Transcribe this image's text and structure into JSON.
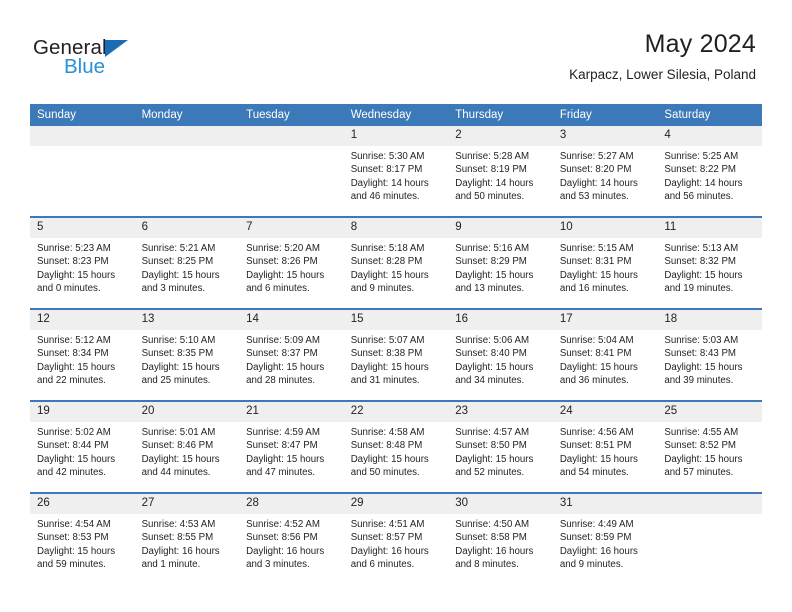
{
  "brand": {
    "name_part1": "General",
    "name_part2": "Blue",
    "triangle_color": "#1b6cb5",
    "blue_text_color": "#2b8fd6"
  },
  "header": {
    "title": "May 2024",
    "subtitle": "Karpacz, Lower Silesia, Poland"
  },
  "theme": {
    "header_bg": "#3b79b8",
    "daynum_bg": "#efefef",
    "text": "#231f20"
  },
  "weekday_headers": [
    "Sunday",
    "Monday",
    "Tuesday",
    "Wednesday",
    "Thursday",
    "Friday",
    "Saturday"
  ],
  "weeks": [
    [
      {
        "day": "",
        "sunrise": "",
        "sunset": "",
        "daylight_line1": "",
        "daylight_line2": ""
      },
      {
        "day": "",
        "sunrise": "",
        "sunset": "",
        "daylight_line1": "",
        "daylight_line2": ""
      },
      {
        "day": "",
        "sunrise": "",
        "sunset": "",
        "daylight_line1": "",
        "daylight_line2": ""
      },
      {
        "day": "1",
        "sunrise": "Sunrise: 5:30 AM",
        "sunset": "Sunset: 8:17 PM",
        "daylight_line1": "Daylight: 14 hours",
        "daylight_line2": "and 46 minutes."
      },
      {
        "day": "2",
        "sunrise": "Sunrise: 5:28 AM",
        "sunset": "Sunset: 8:19 PM",
        "daylight_line1": "Daylight: 14 hours",
        "daylight_line2": "and 50 minutes."
      },
      {
        "day": "3",
        "sunrise": "Sunrise: 5:27 AM",
        "sunset": "Sunset: 8:20 PM",
        "daylight_line1": "Daylight: 14 hours",
        "daylight_line2": "and 53 minutes."
      },
      {
        "day": "4",
        "sunrise": "Sunrise: 5:25 AM",
        "sunset": "Sunset: 8:22 PM",
        "daylight_line1": "Daylight: 14 hours",
        "daylight_line2": "and 56 minutes."
      }
    ],
    [
      {
        "day": "5",
        "sunrise": "Sunrise: 5:23 AM",
        "sunset": "Sunset: 8:23 PM",
        "daylight_line1": "Daylight: 15 hours",
        "daylight_line2": "and 0 minutes."
      },
      {
        "day": "6",
        "sunrise": "Sunrise: 5:21 AM",
        "sunset": "Sunset: 8:25 PM",
        "daylight_line1": "Daylight: 15 hours",
        "daylight_line2": "and 3 minutes."
      },
      {
        "day": "7",
        "sunrise": "Sunrise: 5:20 AM",
        "sunset": "Sunset: 8:26 PM",
        "daylight_line1": "Daylight: 15 hours",
        "daylight_line2": "and 6 minutes."
      },
      {
        "day": "8",
        "sunrise": "Sunrise: 5:18 AM",
        "sunset": "Sunset: 8:28 PM",
        "daylight_line1": "Daylight: 15 hours",
        "daylight_line2": "and 9 minutes."
      },
      {
        "day": "9",
        "sunrise": "Sunrise: 5:16 AM",
        "sunset": "Sunset: 8:29 PM",
        "daylight_line1": "Daylight: 15 hours",
        "daylight_line2": "and 13 minutes."
      },
      {
        "day": "10",
        "sunrise": "Sunrise: 5:15 AM",
        "sunset": "Sunset: 8:31 PM",
        "daylight_line1": "Daylight: 15 hours",
        "daylight_line2": "and 16 minutes."
      },
      {
        "day": "11",
        "sunrise": "Sunrise: 5:13 AM",
        "sunset": "Sunset: 8:32 PM",
        "daylight_line1": "Daylight: 15 hours",
        "daylight_line2": "and 19 minutes."
      }
    ],
    [
      {
        "day": "12",
        "sunrise": "Sunrise: 5:12 AM",
        "sunset": "Sunset: 8:34 PM",
        "daylight_line1": "Daylight: 15 hours",
        "daylight_line2": "and 22 minutes."
      },
      {
        "day": "13",
        "sunrise": "Sunrise: 5:10 AM",
        "sunset": "Sunset: 8:35 PM",
        "daylight_line1": "Daylight: 15 hours",
        "daylight_line2": "and 25 minutes."
      },
      {
        "day": "14",
        "sunrise": "Sunrise: 5:09 AM",
        "sunset": "Sunset: 8:37 PM",
        "daylight_line1": "Daylight: 15 hours",
        "daylight_line2": "and 28 minutes."
      },
      {
        "day": "15",
        "sunrise": "Sunrise: 5:07 AM",
        "sunset": "Sunset: 8:38 PM",
        "daylight_line1": "Daylight: 15 hours",
        "daylight_line2": "and 31 minutes."
      },
      {
        "day": "16",
        "sunrise": "Sunrise: 5:06 AM",
        "sunset": "Sunset: 8:40 PM",
        "daylight_line1": "Daylight: 15 hours",
        "daylight_line2": "and 34 minutes."
      },
      {
        "day": "17",
        "sunrise": "Sunrise: 5:04 AM",
        "sunset": "Sunset: 8:41 PM",
        "daylight_line1": "Daylight: 15 hours",
        "daylight_line2": "and 36 minutes."
      },
      {
        "day": "18",
        "sunrise": "Sunrise: 5:03 AM",
        "sunset": "Sunset: 8:43 PM",
        "daylight_line1": "Daylight: 15 hours",
        "daylight_line2": "and 39 minutes."
      }
    ],
    [
      {
        "day": "19",
        "sunrise": "Sunrise: 5:02 AM",
        "sunset": "Sunset: 8:44 PM",
        "daylight_line1": "Daylight: 15 hours",
        "daylight_line2": "and 42 minutes."
      },
      {
        "day": "20",
        "sunrise": "Sunrise: 5:01 AM",
        "sunset": "Sunset: 8:46 PM",
        "daylight_line1": "Daylight: 15 hours",
        "daylight_line2": "and 44 minutes."
      },
      {
        "day": "21",
        "sunrise": "Sunrise: 4:59 AM",
        "sunset": "Sunset: 8:47 PM",
        "daylight_line1": "Daylight: 15 hours",
        "daylight_line2": "and 47 minutes."
      },
      {
        "day": "22",
        "sunrise": "Sunrise: 4:58 AM",
        "sunset": "Sunset: 8:48 PM",
        "daylight_line1": "Daylight: 15 hours",
        "daylight_line2": "and 50 minutes."
      },
      {
        "day": "23",
        "sunrise": "Sunrise: 4:57 AM",
        "sunset": "Sunset: 8:50 PM",
        "daylight_line1": "Daylight: 15 hours",
        "daylight_line2": "and 52 minutes."
      },
      {
        "day": "24",
        "sunrise": "Sunrise: 4:56 AM",
        "sunset": "Sunset: 8:51 PM",
        "daylight_line1": "Daylight: 15 hours",
        "daylight_line2": "and 54 minutes."
      },
      {
        "day": "25",
        "sunrise": "Sunrise: 4:55 AM",
        "sunset": "Sunset: 8:52 PM",
        "daylight_line1": "Daylight: 15 hours",
        "daylight_line2": "and 57 minutes."
      }
    ],
    [
      {
        "day": "26",
        "sunrise": "Sunrise: 4:54 AM",
        "sunset": "Sunset: 8:53 PM",
        "daylight_line1": "Daylight: 15 hours",
        "daylight_line2": "and 59 minutes."
      },
      {
        "day": "27",
        "sunrise": "Sunrise: 4:53 AM",
        "sunset": "Sunset: 8:55 PM",
        "daylight_line1": "Daylight: 16 hours",
        "daylight_line2": "and 1 minute."
      },
      {
        "day": "28",
        "sunrise": "Sunrise: 4:52 AM",
        "sunset": "Sunset: 8:56 PM",
        "daylight_line1": "Daylight: 16 hours",
        "daylight_line2": "and 3 minutes."
      },
      {
        "day": "29",
        "sunrise": "Sunrise: 4:51 AM",
        "sunset": "Sunset: 8:57 PM",
        "daylight_line1": "Daylight: 16 hours",
        "daylight_line2": "and 6 minutes."
      },
      {
        "day": "30",
        "sunrise": "Sunrise: 4:50 AM",
        "sunset": "Sunset: 8:58 PM",
        "daylight_line1": "Daylight: 16 hours",
        "daylight_line2": "and 8 minutes."
      },
      {
        "day": "31",
        "sunrise": "Sunrise: 4:49 AM",
        "sunset": "Sunset: 8:59 PM",
        "daylight_line1": "Daylight: 16 hours",
        "daylight_line2": "and 9 minutes."
      },
      {
        "day": "",
        "sunrise": "",
        "sunset": "",
        "daylight_line1": "",
        "daylight_line2": ""
      }
    ]
  ]
}
